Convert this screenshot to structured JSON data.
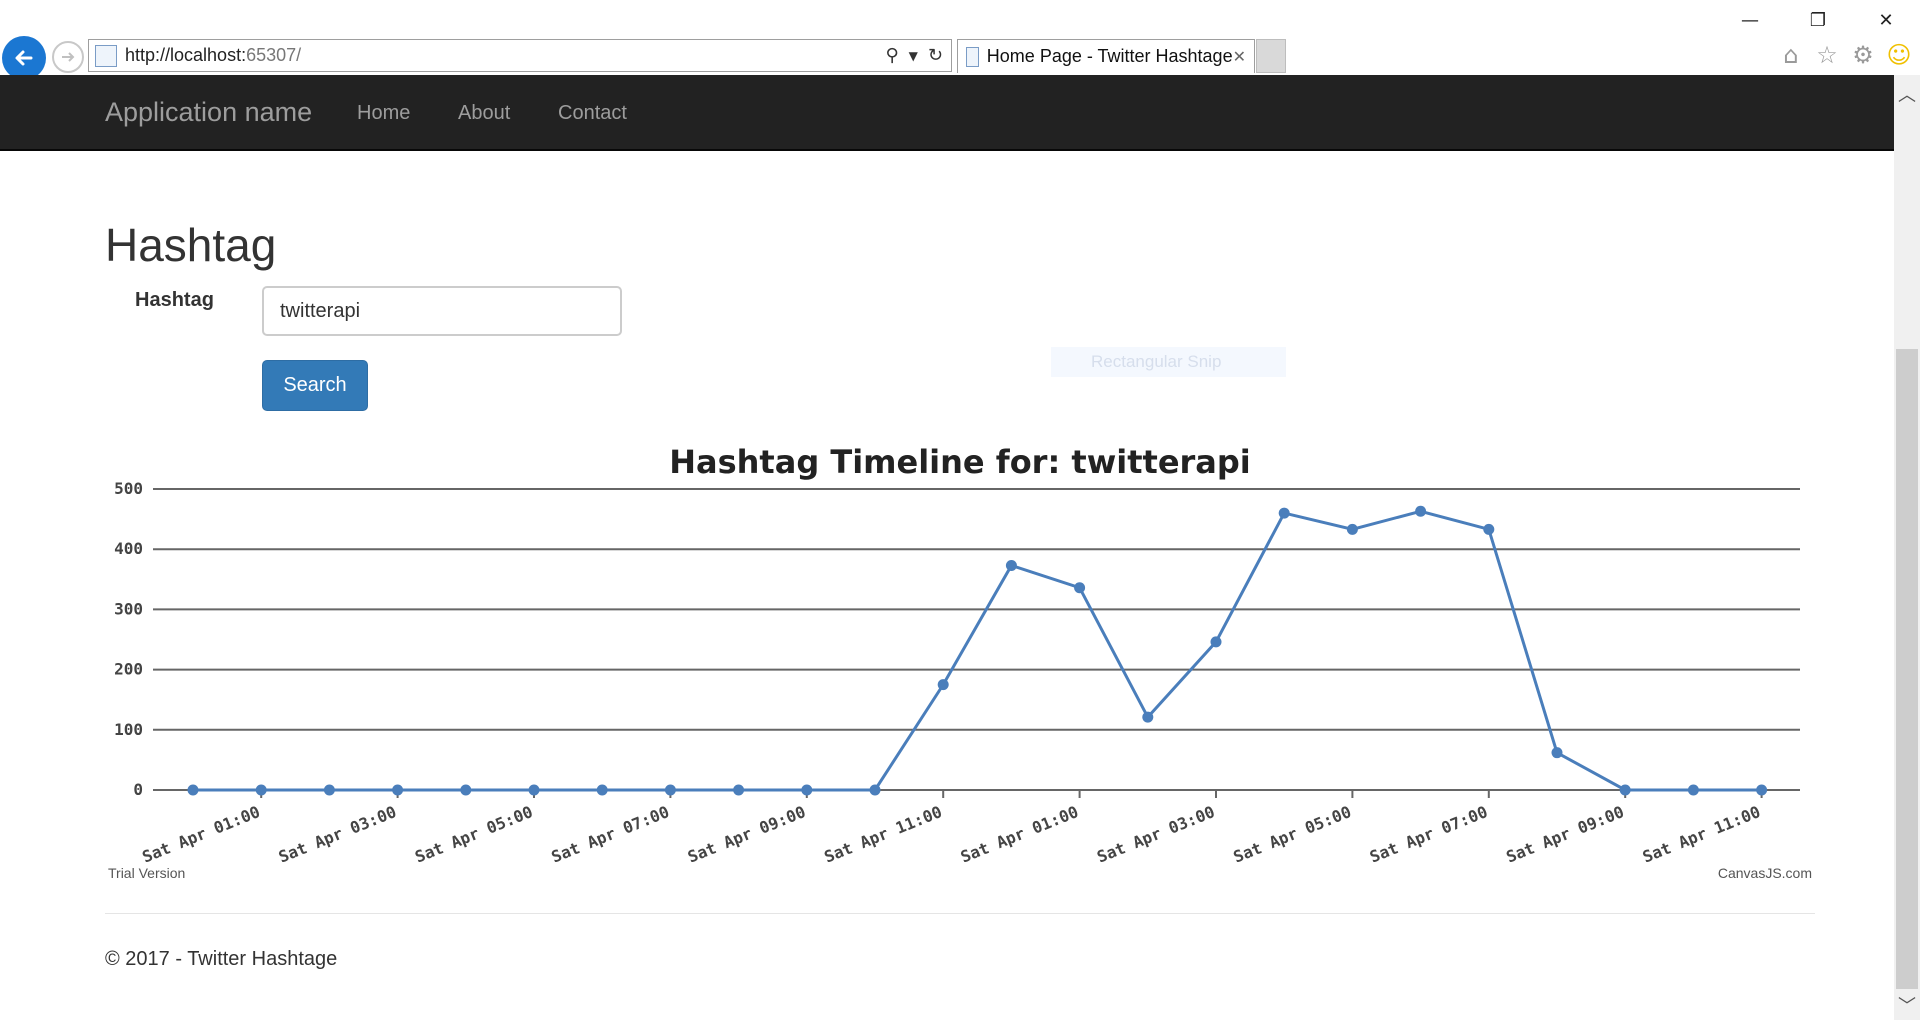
{
  "browser": {
    "url_host": "http://localhost:",
    "url_port": "65307/",
    "tab_title": "Home Page - Twitter Hashtage",
    "window_controls": {
      "minimize": "—",
      "restore": "❐",
      "close": "✕"
    }
  },
  "navbar": {
    "brand": "Application name",
    "links": [
      "Home",
      "About",
      "Contact"
    ]
  },
  "main": {
    "title": "Hashtag",
    "form": {
      "label": "Hashtag",
      "value": "twitterapi",
      "button": "Search"
    },
    "snip_ghost": "Rectangular Snip"
  },
  "chart_data": {
    "type": "line",
    "title": "Hashtag Timeline for: twitterapi",
    "ylim": [
      0,
      500
    ],
    "yticks": [
      0,
      100,
      200,
      300,
      400,
      500
    ],
    "grid": true,
    "color": "#4a7ebb",
    "x_labels": [
      "Sat Apr 01:00",
      "Sat Apr 03:00",
      "Sat Apr 05:00",
      "Sat Apr 07:00",
      "Sat Apr 09:00",
      "Sat Apr 11:00",
      "Sat Apr 01:00",
      "Sat Apr 03:00",
      "Sat Apr 05:00",
      "Sat Apr 07:00",
      "Sat Apr 09:00",
      "Sat Apr 11:00"
    ],
    "values": [
      0,
      0,
      0,
      0,
      0,
      0,
      0,
      0,
      0,
      0,
      0,
      175,
      373,
      336,
      121,
      246,
      460,
      433,
      463,
      433,
      62,
      0,
      0,
      0
    ],
    "credit_left": "Trial Version",
    "credit_right": "CanvasJS.com"
  },
  "footer": {
    "text": "© 2017 - Twitter Hashtage"
  }
}
